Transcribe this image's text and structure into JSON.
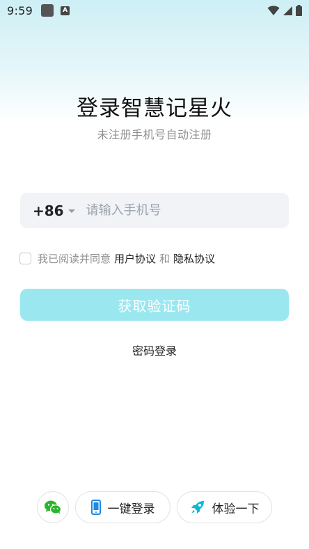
{
  "status_bar": {
    "time": "9:59",
    "icons": [
      "app-notification-icon",
      "a-letter-icon",
      "wifi-icon",
      "signal-icon",
      "battery-icon"
    ]
  },
  "header": {
    "title": "登录智慧记星火",
    "subtitle": "未注册手机号自动注册"
  },
  "phone": {
    "country_code": "+86",
    "placeholder": "请输入手机号",
    "value": ""
  },
  "agreement": {
    "checked": false,
    "prefix": "我已阅读并同意",
    "user_agreement": "用户协议",
    "and": "和",
    "privacy_agreement": "隐私协议"
  },
  "actions": {
    "get_code": "获取验证码",
    "password_login": "密码登录"
  },
  "bottom": {
    "one_key_login": "一键登录",
    "try_it": "体验一下"
  },
  "colors": {
    "primary_button": "#9ae7f0",
    "wechat": "#2bb52b",
    "phone_icon": "#1e88e5",
    "rocket_icon": "#10b6d4"
  }
}
